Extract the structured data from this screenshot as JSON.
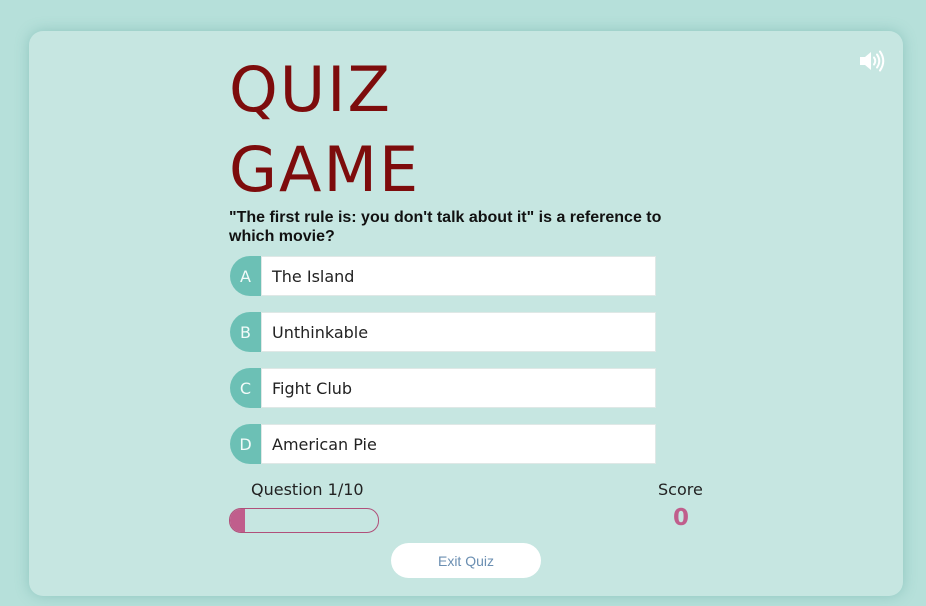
{
  "title": {
    "line1": "QUIZ",
    "line2": "GAME"
  },
  "sound_icon": "speaker-volume-icon",
  "question": {
    "text": "\"The first rule is: you don't talk about it\" is a reference to which movie?",
    "choices": [
      {
        "letter": "A",
        "text": "The Island"
      },
      {
        "letter": "B",
        "text": "Unthinkable"
      },
      {
        "letter": "C",
        "text": "Fight Club"
      },
      {
        "letter": "D",
        "text": "American Pie"
      }
    ]
  },
  "progress": {
    "label": "Question 1/10",
    "current": 1,
    "total": 10,
    "fill_color": "#c05e8c"
  },
  "score": {
    "label": "Score",
    "value": "0"
  },
  "exit_button": {
    "label": "Exit Quiz"
  },
  "colors": {
    "title": "#7d0c0c",
    "accent": "#6cc0b5",
    "score": "#c05e8c",
    "background": "#b6e0da"
  }
}
